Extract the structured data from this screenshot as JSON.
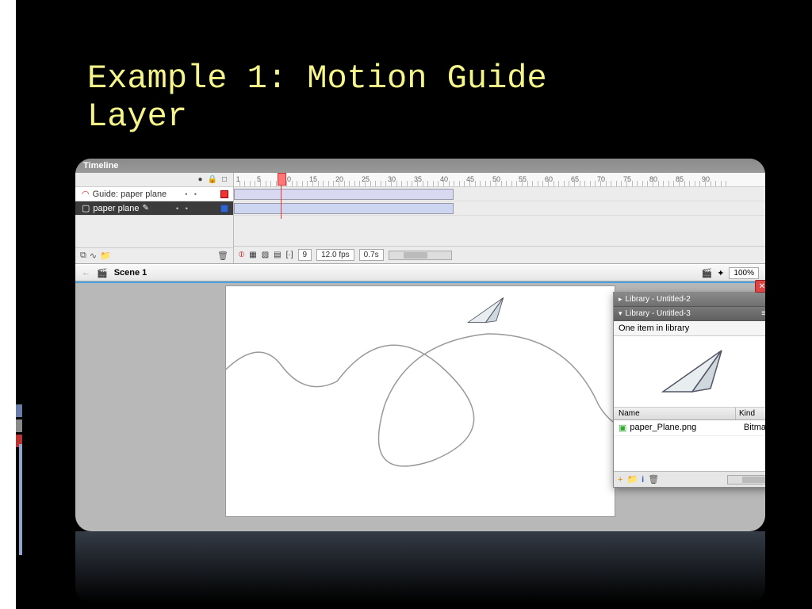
{
  "slide": {
    "title": "Example 1: Motion Guide\nLayer"
  },
  "timeline": {
    "panel_title": "Timeline",
    "layers": [
      {
        "name": "Guide: paper plane",
        "type": "guide"
      },
      {
        "name": "paper plane",
        "type": "normal"
      }
    ],
    "ruler_marks": [
      1,
      5,
      10,
      15,
      20,
      25,
      30,
      35,
      40,
      45,
      50,
      55,
      60,
      65,
      70,
      75,
      80,
      85,
      90
    ],
    "playhead_frame": 9,
    "current_frame": "9",
    "fps": "12.0 fps",
    "elapsed": "0.7s",
    "tween_end_frame": 42
  },
  "scene": {
    "back_label": "←",
    "name": "Scene 1",
    "zoom": "100%"
  },
  "library": {
    "tab1": "Library - Untitled-2",
    "tab2": "Library - Untitled-3",
    "info": "One item in library",
    "col_name": "Name",
    "col_kind": "Kind",
    "item_name": "paper_Plane.png",
    "item_kind": "Bitma"
  },
  "icons": {
    "eye": "●",
    "lock": "🔒",
    "square": "□",
    "folder_add": "⧉",
    "folder": "📁",
    "guide": "∿",
    "trash": "🗑",
    "arrow_l": "◀",
    "arrow_r": "▶",
    "scene_icon": "🎬",
    "plus": "+",
    "info": "i",
    "close": "✕",
    "tri_right": "▸",
    "tri_down": "▾",
    "menu": "≡"
  }
}
